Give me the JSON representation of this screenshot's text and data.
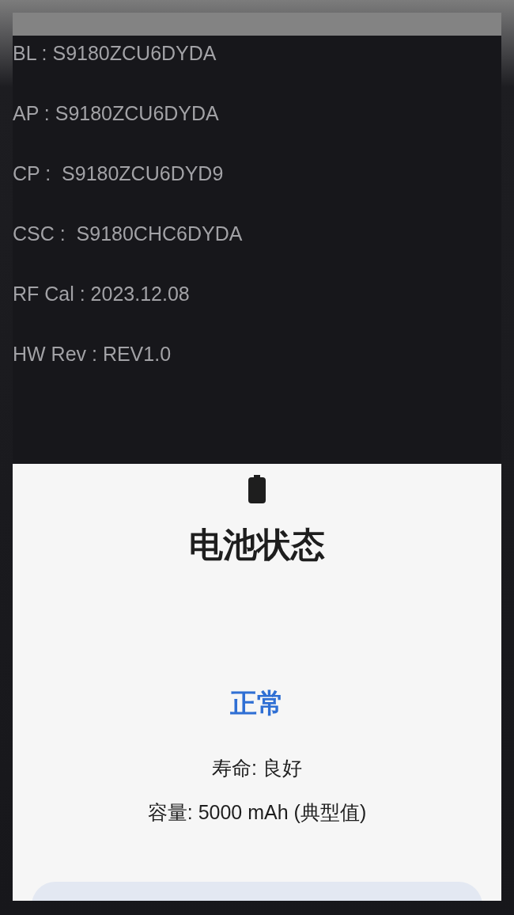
{
  "info_lines": [
    {
      "label": "BL",
      "value": "S9180ZCU6DYDA",
      "separator": " : "
    },
    {
      "label": "AP",
      "value": "S9180ZCU6DYDA",
      "separator": " : "
    },
    {
      "label": "CP",
      "value": "S9180ZCU6DYD9",
      "separator": " :  "
    },
    {
      "label": "CSC",
      "value": "S9180CHC6DYDA",
      "separator": " :  "
    },
    {
      "label": "RF Cal",
      "value": "2023.12.08",
      "separator": " : "
    },
    {
      "label": "HW Rev",
      "value": "REV1.0",
      "separator": " : "
    }
  ],
  "battery_card": {
    "title": "电池状态",
    "status": "正常",
    "lines": [
      "寿命: 良好",
      "容量: 5000 mAh (典型值)"
    ]
  }
}
